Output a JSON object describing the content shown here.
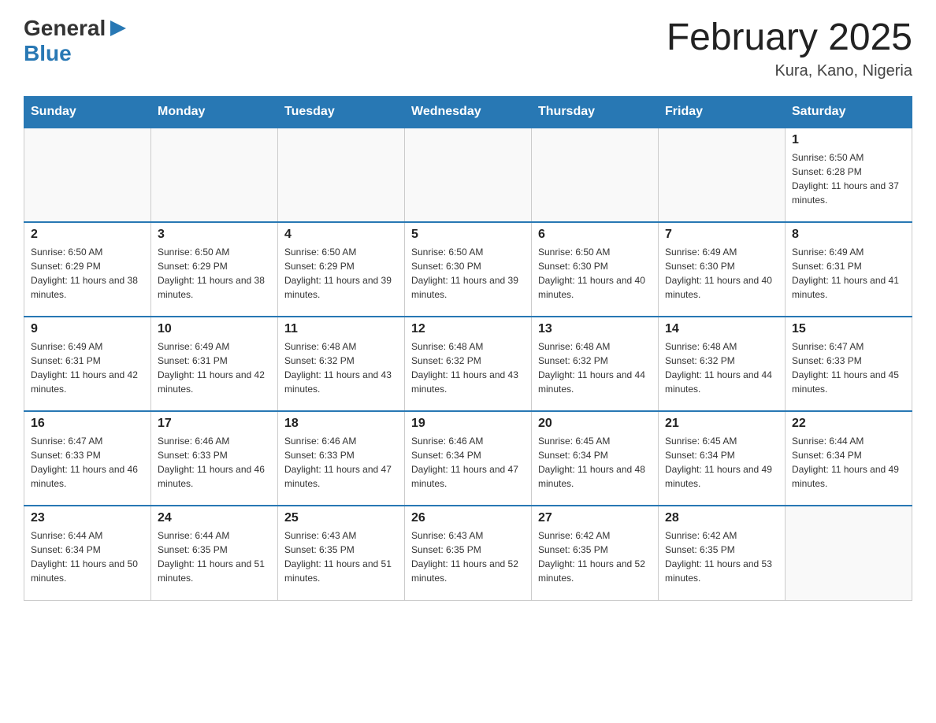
{
  "header": {
    "logo_general": "General",
    "logo_blue": "Blue",
    "month_title": "February 2025",
    "location": "Kura, Kano, Nigeria"
  },
  "weekdays": [
    "Sunday",
    "Monday",
    "Tuesday",
    "Wednesday",
    "Thursday",
    "Friday",
    "Saturday"
  ],
  "weeks": [
    [
      {
        "day": "",
        "sunrise": "",
        "sunset": "",
        "daylight": ""
      },
      {
        "day": "",
        "sunrise": "",
        "sunset": "",
        "daylight": ""
      },
      {
        "day": "",
        "sunrise": "",
        "sunset": "",
        "daylight": ""
      },
      {
        "day": "",
        "sunrise": "",
        "sunset": "",
        "daylight": ""
      },
      {
        "day": "",
        "sunrise": "",
        "sunset": "",
        "daylight": ""
      },
      {
        "day": "",
        "sunrise": "",
        "sunset": "",
        "daylight": ""
      },
      {
        "day": "1",
        "sunrise": "Sunrise: 6:50 AM",
        "sunset": "Sunset: 6:28 PM",
        "daylight": "Daylight: 11 hours and 37 minutes."
      }
    ],
    [
      {
        "day": "2",
        "sunrise": "Sunrise: 6:50 AM",
        "sunset": "Sunset: 6:29 PM",
        "daylight": "Daylight: 11 hours and 38 minutes."
      },
      {
        "day": "3",
        "sunrise": "Sunrise: 6:50 AM",
        "sunset": "Sunset: 6:29 PM",
        "daylight": "Daylight: 11 hours and 38 minutes."
      },
      {
        "day": "4",
        "sunrise": "Sunrise: 6:50 AM",
        "sunset": "Sunset: 6:29 PM",
        "daylight": "Daylight: 11 hours and 39 minutes."
      },
      {
        "day": "5",
        "sunrise": "Sunrise: 6:50 AM",
        "sunset": "Sunset: 6:30 PM",
        "daylight": "Daylight: 11 hours and 39 minutes."
      },
      {
        "day": "6",
        "sunrise": "Sunrise: 6:50 AM",
        "sunset": "Sunset: 6:30 PM",
        "daylight": "Daylight: 11 hours and 40 minutes."
      },
      {
        "day": "7",
        "sunrise": "Sunrise: 6:49 AM",
        "sunset": "Sunset: 6:30 PM",
        "daylight": "Daylight: 11 hours and 40 minutes."
      },
      {
        "day": "8",
        "sunrise": "Sunrise: 6:49 AM",
        "sunset": "Sunset: 6:31 PM",
        "daylight": "Daylight: 11 hours and 41 minutes."
      }
    ],
    [
      {
        "day": "9",
        "sunrise": "Sunrise: 6:49 AM",
        "sunset": "Sunset: 6:31 PM",
        "daylight": "Daylight: 11 hours and 42 minutes."
      },
      {
        "day": "10",
        "sunrise": "Sunrise: 6:49 AM",
        "sunset": "Sunset: 6:31 PM",
        "daylight": "Daylight: 11 hours and 42 minutes."
      },
      {
        "day": "11",
        "sunrise": "Sunrise: 6:48 AM",
        "sunset": "Sunset: 6:32 PM",
        "daylight": "Daylight: 11 hours and 43 minutes."
      },
      {
        "day": "12",
        "sunrise": "Sunrise: 6:48 AM",
        "sunset": "Sunset: 6:32 PM",
        "daylight": "Daylight: 11 hours and 43 minutes."
      },
      {
        "day": "13",
        "sunrise": "Sunrise: 6:48 AM",
        "sunset": "Sunset: 6:32 PM",
        "daylight": "Daylight: 11 hours and 44 minutes."
      },
      {
        "day": "14",
        "sunrise": "Sunrise: 6:48 AM",
        "sunset": "Sunset: 6:32 PM",
        "daylight": "Daylight: 11 hours and 44 minutes."
      },
      {
        "day": "15",
        "sunrise": "Sunrise: 6:47 AM",
        "sunset": "Sunset: 6:33 PM",
        "daylight": "Daylight: 11 hours and 45 minutes."
      }
    ],
    [
      {
        "day": "16",
        "sunrise": "Sunrise: 6:47 AM",
        "sunset": "Sunset: 6:33 PM",
        "daylight": "Daylight: 11 hours and 46 minutes."
      },
      {
        "day": "17",
        "sunrise": "Sunrise: 6:46 AM",
        "sunset": "Sunset: 6:33 PM",
        "daylight": "Daylight: 11 hours and 46 minutes."
      },
      {
        "day": "18",
        "sunrise": "Sunrise: 6:46 AM",
        "sunset": "Sunset: 6:33 PM",
        "daylight": "Daylight: 11 hours and 47 minutes."
      },
      {
        "day": "19",
        "sunrise": "Sunrise: 6:46 AM",
        "sunset": "Sunset: 6:34 PM",
        "daylight": "Daylight: 11 hours and 47 minutes."
      },
      {
        "day": "20",
        "sunrise": "Sunrise: 6:45 AM",
        "sunset": "Sunset: 6:34 PM",
        "daylight": "Daylight: 11 hours and 48 minutes."
      },
      {
        "day": "21",
        "sunrise": "Sunrise: 6:45 AM",
        "sunset": "Sunset: 6:34 PM",
        "daylight": "Daylight: 11 hours and 49 minutes."
      },
      {
        "day": "22",
        "sunrise": "Sunrise: 6:44 AM",
        "sunset": "Sunset: 6:34 PM",
        "daylight": "Daylight: 11 hours and 49 minutes."
      }
    ],
    [
      {
        "day": "23",
        "sunrise": "Sunrise: 6:44 AM",
        "sunset": "Sunset: 6:34 PM",
        "daylight": "Daylight: 11 hours and 50 minutes."
      },
      {
        "day": "24",
        "sunrise": "Sunrise: 6:44 AM",
        "sunset": "Sunset: 6:35 PM",
        "daylight": "Daylight: 11 hours and 51 minutes."
      },
      {
        "day": "25",
        "sunrise": "Sunrise: 6:43 AM",
        "sunset": "Sunset: 6:35 PM",
        "daylight": "Daylight: 11 hours and 51 minutes."
      },
      {
        "day": "26",
        "sunrise": "Sunrise: 6:43 AM",
        "sunset": "Sunset: 6:35 PM",
        "daylight": "Daylight: 11 hours and 52 minutes."
      },
      {
        "day": "27",
        "sunrise": "Sunrise: 6:42 AM",
        "sunset": "Sunset: 6:35 PM",
        "daylight": "Daylight: 11 hours and 52 minutes."
      },
      {
        "day": "28",
        "sunrise": "Sunrise: 6:42 AM",
        "sunset": "Sunset: 6:35 PM",
        "daylight": "Daylight: 11 hours and 53 minutes."
      },
      {
        "day": "",
        "sunrise": "",
        "sunset": "",
        "daylight": ""
      }
    ]
  ]
}
